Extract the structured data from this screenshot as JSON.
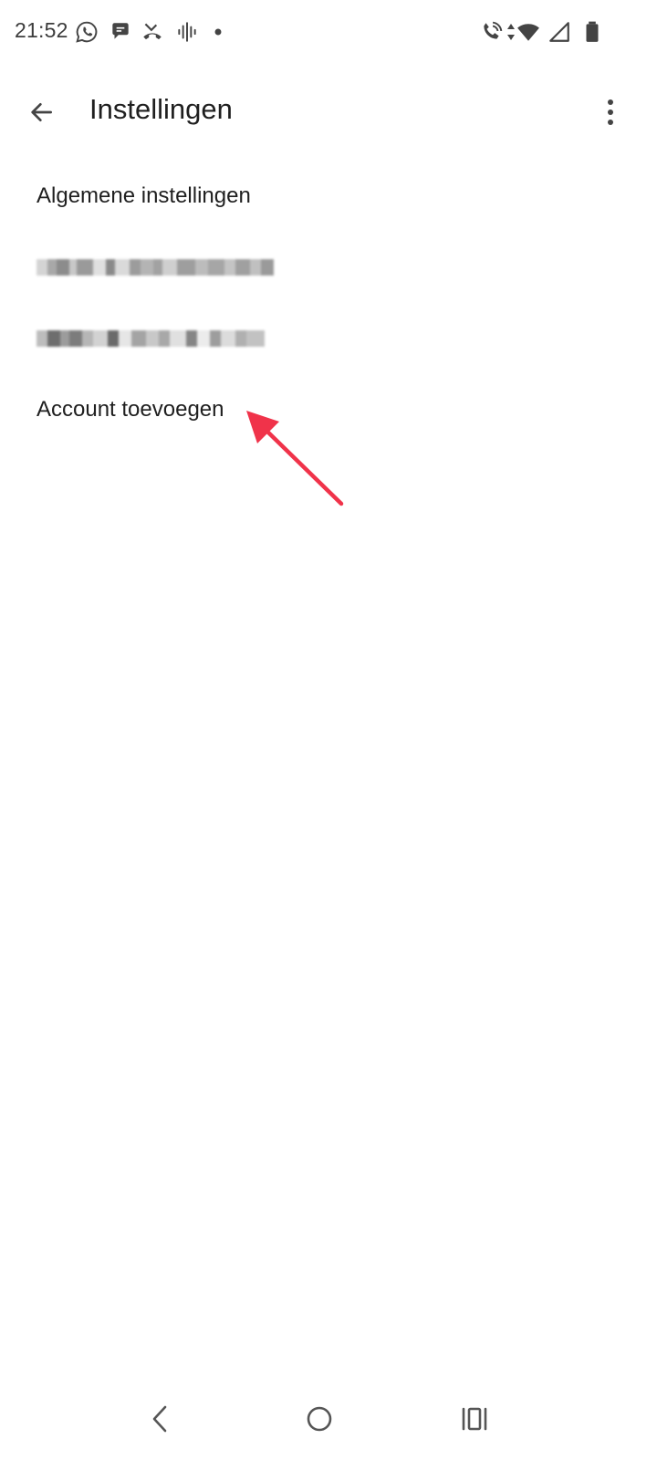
{
  "status_bar": {
    "time": "21:52",
    "left_icons": [
      "whatsapp-icon",
      "chat-bubble-icon",
      "missed-call-icon",
      "voice-wave-icon",
      "dot-icon"
    ],
    "right_icons": [
      "wifi-call-icon",
      "data-arrows-icon",
      "wifi-icon",
      "signal-icon",
      "battery-icon"
    ]
  },
  "app_bar": {
    "title": "Instellingen",
    "back_icon": "arrow-back-icon",
    "menu_icon": "more-vert-icon"
  },
  "settings": {
    "items": [
      {
        "label": "Algemene instellingen",
        "redacted": false
      },
      {
        "label": "",
        "redacted": true
      },
      {
        "label": "",
        "redacted": true
      },
      {
        "label": "Account toevoegen",
        "redacted": false
      }
    ]
  },
  "annotation": {
    "arrow_color": "#f0334a"
  },
  "nav_bar": {
    "back": "nav-back-icon",
    "home": "nav-home-icon",
    "recents": "nav-recents-icon"
  }
}
